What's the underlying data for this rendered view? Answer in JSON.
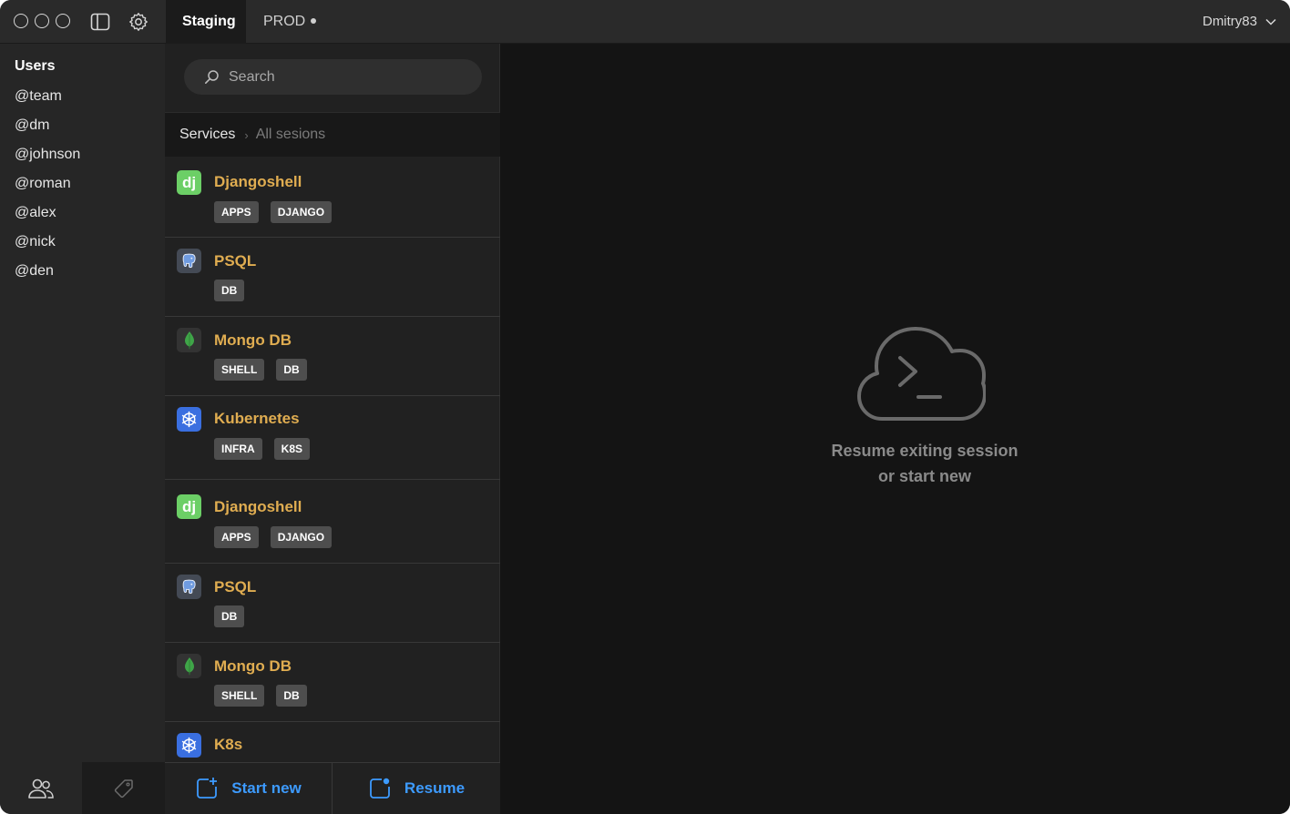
{
  "topbar": {
    "window_controls": [
      "close",
      "minimize",
      "maximize"
    ],
    "icons": [
      "sidebar-toggle-icon",
      "settings-gear-icon"
    ],
    "tabs": [
      {
        "label": "Staging",
        "active": true,
        "modified": false
      },
      {
        "label": "PROD",
        "active": false,
        "modified": true
      }
    ],
    "user": {
      "name": "Dmitry83",
      "icon": "chevron-down-icon"
    }
  },
  "sidebar": {
    "heading": "Users",
    "users": [
      "@team",
      "@dm",
      "@johnson",
      "@roman",
      "@alex",
      "@nick",
      "@den"
    ],
    "bottom_icons": [
      "users-icon",
      "tag-icon"
    ]
  },
  "panel": {
    "search": {
      "placeholder": "Search",
      "value": ""
    },
    "breadcrumb": {
      "root": "Services",
      "current": "All sesions"
    },
    "items": [
      {
        "title": "Djangoshell",
        "icon": "django-logo",
        "tags": [
          "APPS",
          "DJANGO"
        ]
      },
      {
        "title": "PSQL",
        "icon": "postgresql-logo",
        "tags": [
          "DB"
        ]
      },
      {
        "title": "Mongo DB",
        "icon": "mongodb-logo",
        "tags": [
          "SHELL",
          "DB"
        ]
      },
      {
        "title": "Kubernetes",
        "icon": "kubernetes-logo",
        "tags": [
          "INFRA",
          "K8S"
        ]
      },
      {
        "title": "Djangoshell",
        "icon": "django-logo",
        "tags": [
          "APPS",
          "DJANGO"
        ]
      },
      {
        "title": "PSQL",
        "icon": "postgresql-logo",
        "tags": [
          "DB"
        ]
      },
      {
        "title": "Mongo DB",
        "icon": "mongodb-logo",
        "tags": [
          "SHELL",
          "DB"
        ]
      },
      {
        "title": "K8s",
        "icon": "kubernetes-logo",
        "tags": []
      }
    ],
    "actions": {
      "start_new": "Start new",
      "resume": "Resume"
    }
  },
  "main": {
    "empty_state": {
      "icon": "cloud-terminal-icon",
      "line1": "Resume exiting session",
      "line2": "or start new"
    }
  },
  "colors": {
    "accent": "#3d9bff",
    "item_title": "#e0ad51",
    "tag_bg": "#4e4e4e",
    "django": "#6ccf66",
    "kubernetes": "#3a6fe0"
  }
}
